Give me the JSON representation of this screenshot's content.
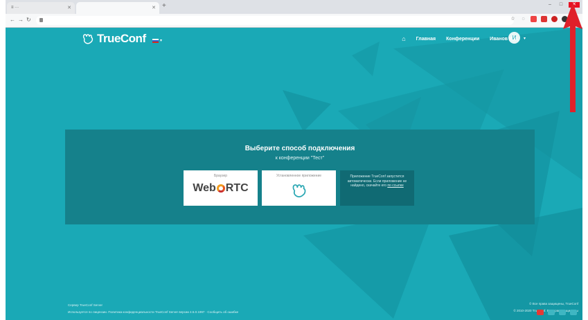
{
  "browser": {
    "tabs": [
      {
        "label": "≡ ···",
        "active": false
      },
      {
        "label": "",
        "active": true
      }
    ],
    "address": "",
    "icons": [
      "back-icon",
      "forward-icon",
      "reload-icon",
      "lock-icon",
      "star-icon",
      "extension-icons",
      "profile-icon",
      "menu-icon"
    ]
  },
  "site": {
    "brand": "TrueConf",
    "nav": {
      "home_icon": "⌂",
      "item1": "Главная",
      "item2": "Конференции",
      "item3": "Иванов И.И."
    },
    "avatar_initial": "И"
  },
  "join": {
    "title": "Выберите способ подключения",
    "subtitle": "к конференции \"Тест\"",
    "webrtc_caption": "Браузер",
    "webrtc_logo_left": "Web",
    "webrtc_logo_right": "RTC",
    "app_caption": "Установленное приложение",
    "info_text": "Приложение TrueConf запустится автоматически. Если приложение не найдено, скачайте его",
    "info_link": "по ссылке"
  },
  "footer": {
    "left_line1": "Сервер TrueConf Server",
    "left_line2": "Используется по лицензии. Политика конфиденциальности TrueConf Server версии 4.5.0.1997 · Сообщить об ошибке",
    "right_line1": "© Все права защищены, TrueConf",
    "right_line2": "© 2010-2020 TrueConf. Все права защищены"
  },
  "colors": {
    "page_bg": "#1aa9b6",
    "panel_bg": "#15818b",
    "arrow": "#e0202a"
  }
}
